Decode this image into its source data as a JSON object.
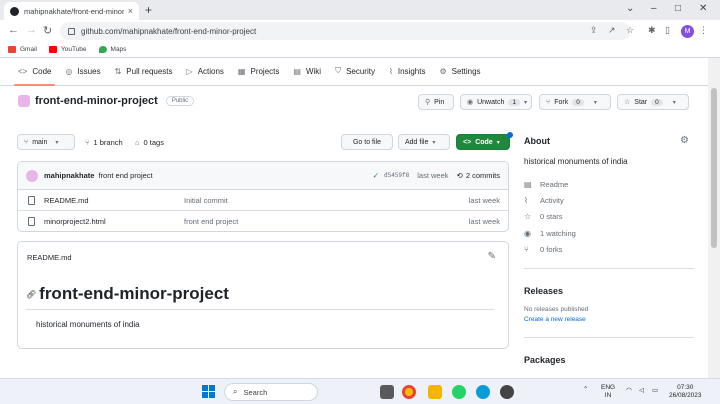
{
  "browser": {
    "tab_title": "mahipnakhate/front-end-minor",
    "tab_close": "×",
    "new_tab": "+",
    "url": "github.com/mahipnakhate/front-end-minor-project",
    "avatar_letter": "M",
    "bookmarks": [
      {
        "label": "Gmail",
        "color": "#ea4335"
      },
      {
        "label": "YouTube",
        "color": "#ff0000"
      },
      {
        "label": "Maps",
        "color": "#34a853"
      }
    ]
  },
  "repo_nav": [
    {
      "label": "Code",
      "icon": "<>",
      "active": true
    },
    {
      "label": "Issues",
      "icon": "◎"
    },
    {
      "label": "Pull requests",
      "icon": "⇅"
    },
    {
      "label": "Actions",
      "icon": "▷"
    },
    {
      "label": "Projects",
      "icon": "▦"
    },
    {
      "label": "Wiki",
      "icon": "▤"
    },
    {
      "label": "Security",
      "icon": "⛉"
    },
    {
      "label": "Insights",
      "icon": "⌇"
    },
    {
      "label": "Settings",
      "icon": "⚙"
    }
  ],
  "repo": {
    "name": "front-end-minor-project",
    "visibility": "Public",
    "pin": "Pin",
    "unwatch": "Unwatch",
    "unwatch_count": "1",
    "fork": "Fork",
    "fork_count": "0",
    "star": "Star",
    "star_count": "0"
  },
  "branchbar": {
    "branch": "main",
    "branches": "1 branch",
    "tags": "0 tags",
    "goto": "Go to file",
    "addfile": "Add file",
    "code": "Code"
  },
  "latest_commit": {
    "author": "mahipnakhate",
    "message": "front end project",
    "sha": "d5459f8",
    "when": "last week",
    "commits": "2 commits"
  },
  "files": [
    {
      "name": "README.md",
      "message": "Initial commit",
      "when": "last week"
    },
    {
      "name": "minorproject2.html",
      "message": "front end project",
      "when": "last week"
    }
  ],
  "readme": {
    "header": "README.md",
    "title": "front-end-minor-project",
    "body": "historical monuments of india"
  },
  "about": {
    "heading": "About",
    "description": "historical monuments of india",
    "items": [
      {
        "icon": "book-icon",
        "label": "Readme"
      },
      {
        "icon": "pulse-icon",
        "label": "Activity"
      },
      {
        "icon": "star-icon",
        "label": "0 stars"
      },
      {
        "icon": "eye-icon",
        "label": "1 watching"
      },
      {
        "icon": "fork-icon",
        "label": "0 forks"
      }
    ]
  },
  "releases": {
    "heading": "Releases",
    "none": "No releases published",
    "create": "Create a new release"
  },
  "packages": {
    "heading": "Packages"
  },
  "taskbar": {
    "search": "Search",
    "lang1": "ENG",
    "lang2": "IN",
    "time": "07:30",
    "date": "26/08/2023"
  }
}
